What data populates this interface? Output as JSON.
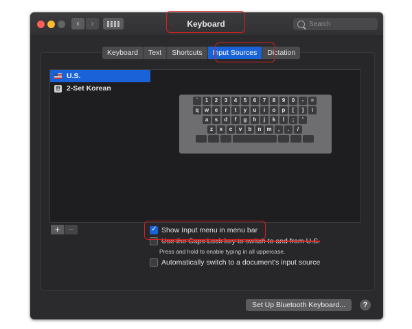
{
  "window": {
    "title": "Keyboard",
    "nav_back": "‹",
    "nav_forward": "›",
    "search_placeholder": "Search"
  },
  "tabs": [
    {
      "label": "Keyboard",
      "active": false
    },
    {
      "label": "Text",
      "active": false
    },
    {
      "label": "Shortcuts",
      "active": false
    },
    {
      "label": "Input Sources",
      "active": true
    },
    {
      "label": "Dictation",
      "active": false
    }
  ],
  "sources": [
    {
      "label": "U.S.",
      "icon": "us-flag-icon",
      "selected": true
    },
    {
      "label": "2-Set Korean",
      "icon": "korean-input-icon",
      "icon_glyph": "한",
      "selected": false
    }
  ],
  "keyboard_rows": [
    [
      "`",
      "1",
      "2",
      "3",
      "4",
      "5",
      "6",
      "7",
      "8",
      "9",
      "0",
      "-",
      "="
    ],
    [
      "q",
      "w",
      "e",
      "r",
      "t",
      "y",
      "u",
      "i",
      "o",
      "p",
      "[",
      "]",
      "\\"
    ],
    [
      "a",
      "s",
      "d",
      "f",
      "g",
      "h",
      "j",
      "k",
      "l",
      ";",
      "'"
    ],
    [
      "z",
      "x",
      "c",
      "v",
      "b",
      "n",
      "m",
      ",",
      ".",
      "/"
    ],
    [
      "",
      "",
      "",
      "",
      "",
      "",
      ""
    ]
  ],
  "list_controls": {
    "add": "+",
    "remove": "−"
  },
  "options": {
    "show_menu": {
      "label": "Show Input menu in menu bar",
      "checked": true
    },
    "caps_lock": {
      "label": "Use the Caps Lock key to switch to and from U.S.",
      "checked": false
    },
    "caps_note": "Press and hold to enable typing in all uppercase.",
    "auto_switch": {
      "label": "Automatically switch to a document's input source",
      "checked": false
    }
  },
  "buttons": {
    "bluetooth": "Set Up Bluetooth Keyboard...",
    "help": "?"
  },
  "colors": {
    "accent": "#1a62d8",
    "highlight": "#d61f1f",
    "window_bg": "#2b2b2d"
  }
}
